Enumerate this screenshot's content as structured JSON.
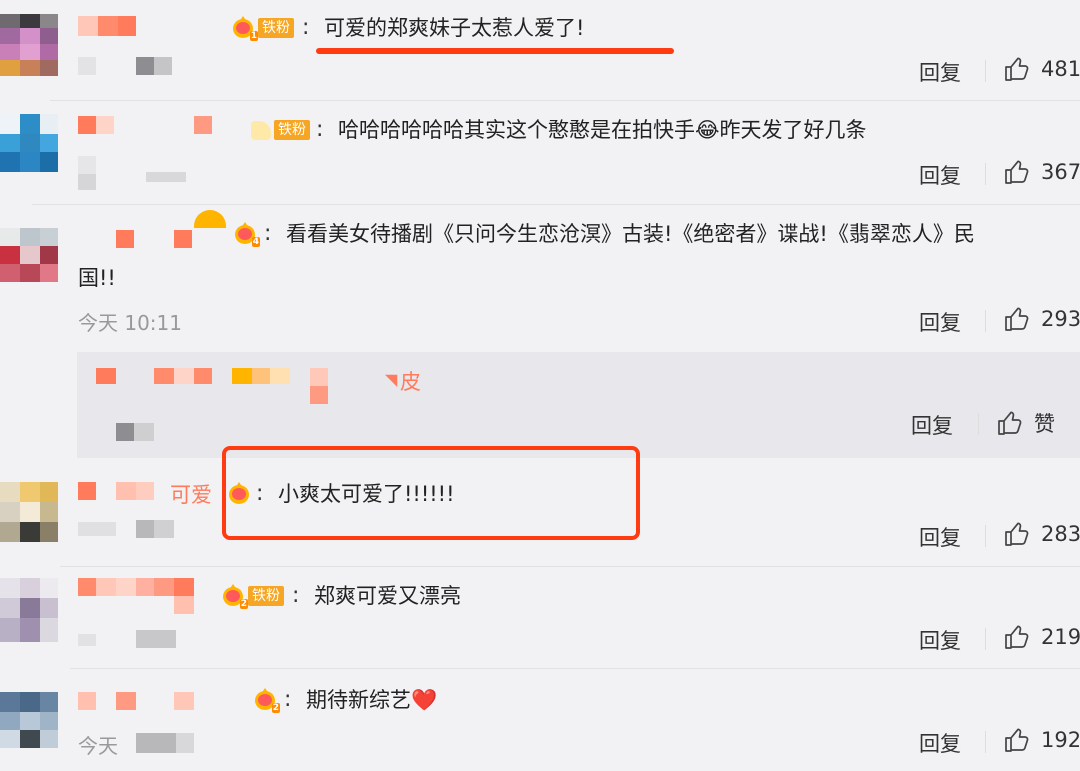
{
  "colors": {
    "background": "#f2f2f4",
    "accent_red": "#ff3b12",
    "fan_badge": "#f6a623",
    "mosaic": "#ff7b5c"
  },
  "badge_label": "铁粉",
  "reply_label": "回复",
  "like_icon": "thumbs-up-icon",
  "comments": [
    {
      "text": "可爱的郑爽妹子太惹人爱了!",
      "time": "",
      "likes": "481",
      "badge_level": "1"
    },
    {
      "text": "哈哈哈哈哈哈其实这个憨憨是在拍快手",
      "emoji": "😂",
      "text_after": "昨天发了好几条",
      "time": "",
      "likes": "367"
    },
    {
      "text": "看看美女待播剧《只问今生恋沧溟》古装!《绝密者》谍战!《翡翠恋人》民",
      "text_line2": "国!!",
      "time": "今天 10:11",
      "likes": "293",
      "badge_level": "4"
    },
    {
      "text": "小爽太可爱了!!!!!!",
      "name_visible": "可爱",
      "time": "",
      "likes": "283"
    },
    {
      "text": "郑爽可爱又漂亮",
      "time": "",
      "likes": "219",
      "badge_level": "2"
    },
    {
      "text": "期待新综艺",
      "emoji": "❤️",
      "time": "今天",
      "likes": "192",
      "badge_level": "2"
    }
  ],
  "nested_reply": {
    "name_visible": "皮",
    "reply_label": "回复",
    "like_label": "赞"
  }
}
